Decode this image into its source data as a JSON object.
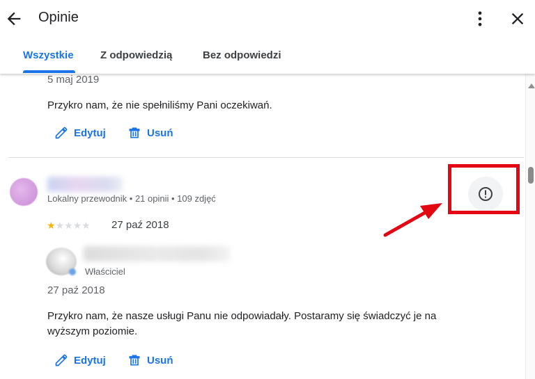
{
  "header": {
    "title": "Opinie",
    "tabs": [
      {
        "label": "Wszystkie",
        "active": true
      },
      {
        "label": "Z odpowiedzią",
        "active": false
      },
      {
        "label": "Bez odpowiedzi",
        "active": false
      }
    ]
  },
  "reply_top": {
    "date": "5 maj 2019",
    "text": "Przykro nam, że nie spełniliśmy Pani oczekiwań.",
    "edit_label": "Edytuj",
    "delete_label": "Usuń"
  },
  "review": {
    "meta": "Lokalny przewodnik • 21 opinii • 109 zdjęć",
    "rating": 1,
    "rating_max": 5,
    "date": "27 paź 2018",
    "reply": {
      "role": "Właściciel",
      "date": "27 paź 2018",
      "text_line1": "Przykro nam, że nasze usługi Panu nie odpowiadały. Postaramy się świadczyć je na",
      "text_line2": "wyższym poziomie.",
      "edit_label": "Edytuj",
      "delete_label": "Usuń"
    }
  },
  "colors": {
    "accent": "#1a73e8",
    "highlight": "#e30613",
    "star": "#f9b400"
  },
  "icons": [
    "back-arrow-icon",
    "more-vert-icon",
    "close-icon",
    "edit-pencil-icon",
    "trash-icon",
    "report-flag-icon"
  ]
}
